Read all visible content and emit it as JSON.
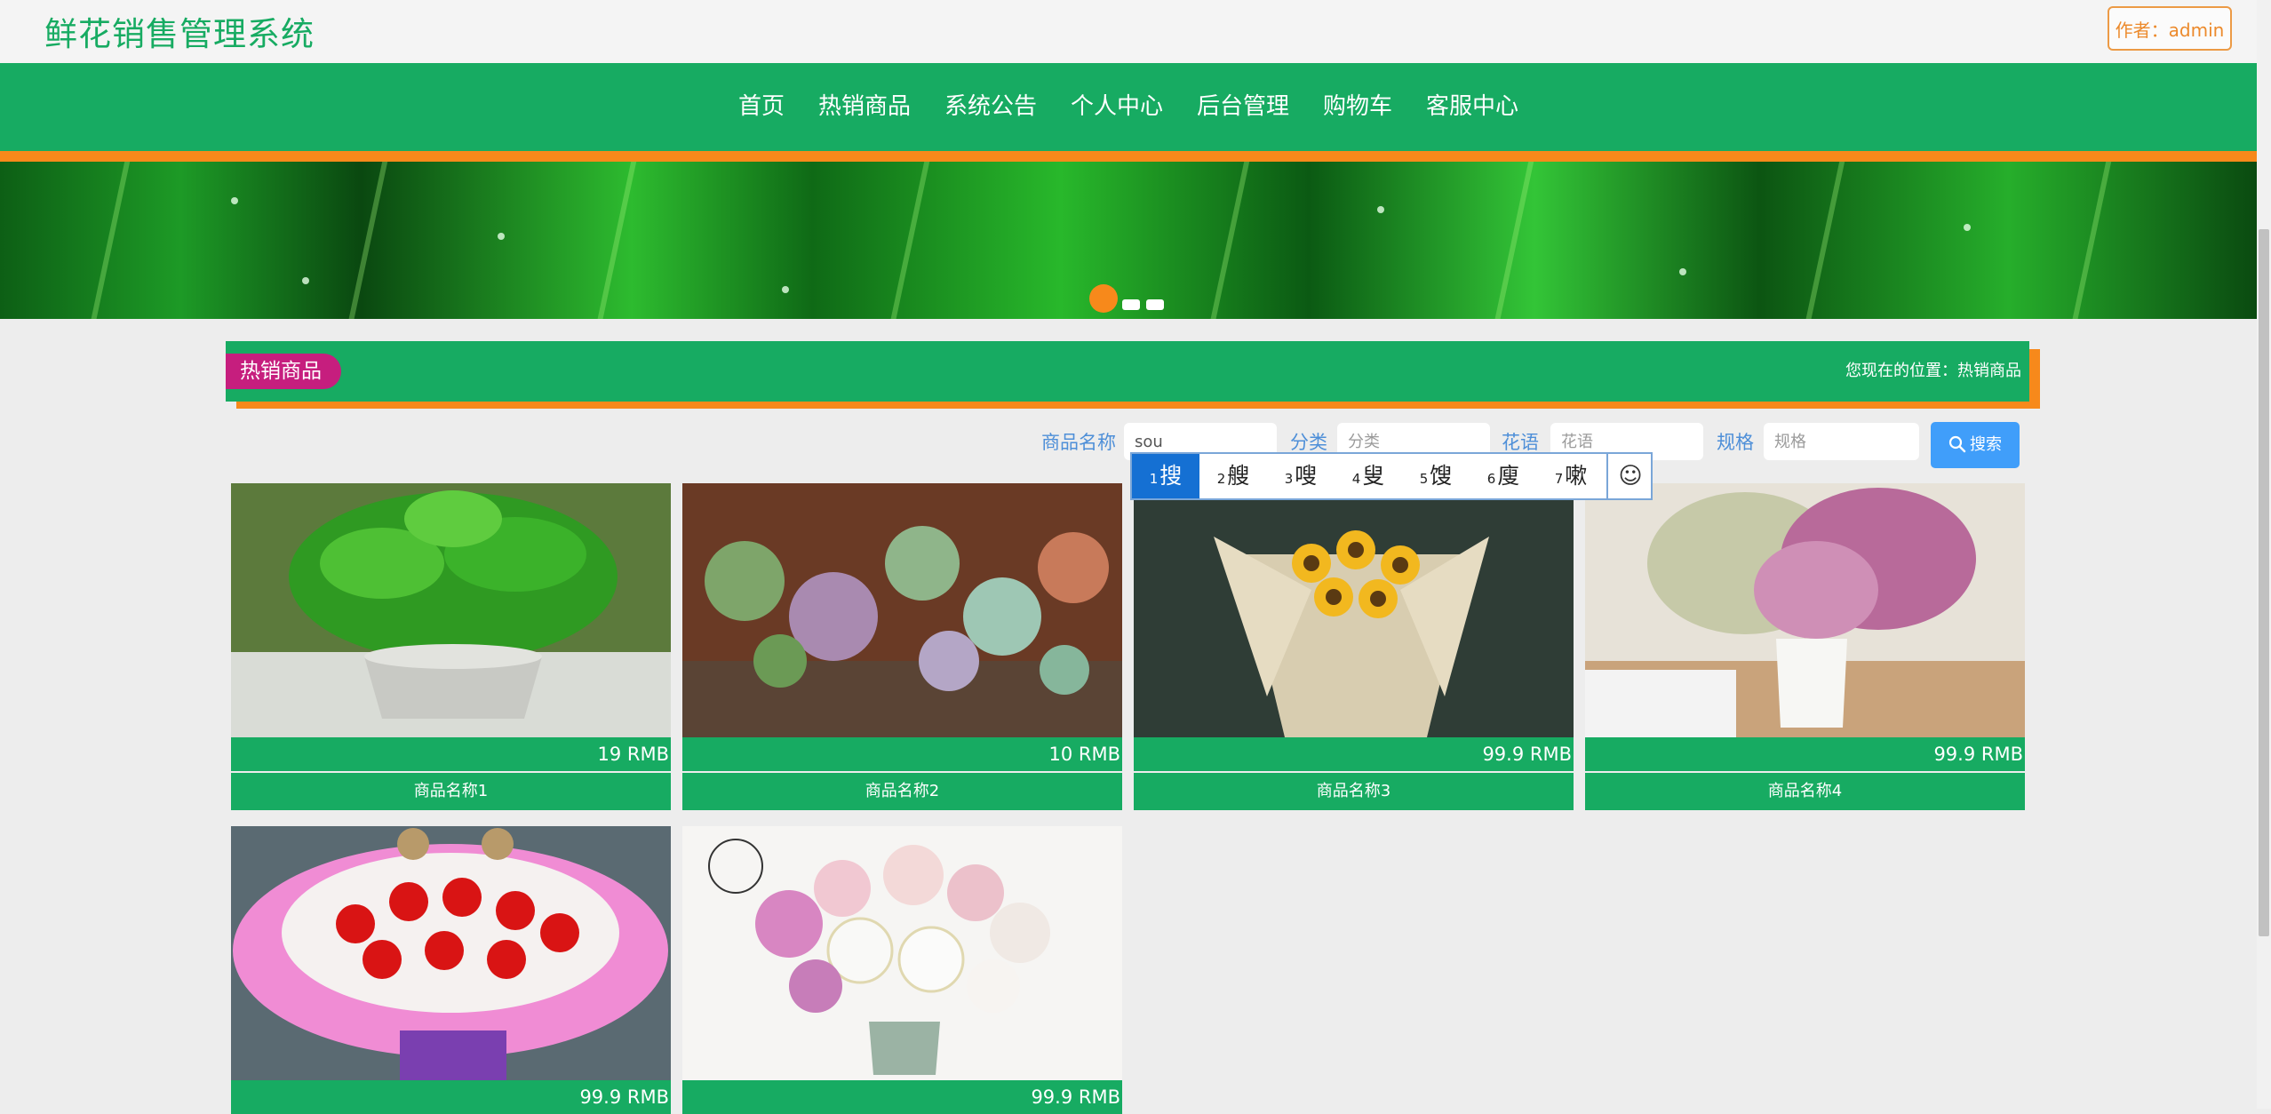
{
  "header": {
    "site_title": "鲜花销售管理系统",
    "author_label": "作者：admin"
  },
  "nav": {
    "items": [
      "首页",
      "热销商品",
      "系统公告",
      "个人中心",
      "后台管理",
      "购物车",
      "客服中心"
    ]
  },
  "section": {
    "title": "热销商品",
    "breadcrumb": "您现在的位置：热销商品"
  },
  "search": {
    "name_label": "商品名称",
    "name_value": "sou",
    "category_label": "分类",
    "category_placeholder": "分类",
    "flower_language_label": "花语",
    "flower_language_placeholder": "花语",
    "spec_label": "规格",
    "spec_placeholder": "规格",
    "button_label": "搜索"
  },
  "ime": {
    "candidates": [
      {
        "num": "1",
        "char": "搜"
      },
      {
        "num": "2",
        "char": "艘"
      },
      {
        "num": "3",
        "char": "嗖"
      },
      {
        "num": "4",
        "char": "叟"
      },
      {
        "num": "5",
        "char": "馊"
      },
      {
        "num": "6",
        "char": "廋"
      },
      {
        "num": "7",
        "char": "嗽"
      }
    ],
    "emoji_icon": "smiley-icon"
  },
  "products": [
    {
      "price": "19 RMB",
      "name": "商品名称1"
    },
    {
      "price": "10 RMB",
      "name": "商品名称2"
    },
    {
      "price": "99.9 RMB",
      "name": "商品名称3"
    },
    {
      "price": "99.9 RMB",
      "name": "商品名称4"
    },
    {
      "price": "99.9 RMB",
      "name": ""
    },
    {
      "price": "99.9 RMB",
      "name": ""
    }
  ],
  "colors": {
    "brand_green": "#17ab62",
    "accent_orange": "#f7891b",
    "title_magenta": "#c61e7e",
    "link_blue": "#4e8fd8",
    "button_blue": "#409efa"
  }
}
